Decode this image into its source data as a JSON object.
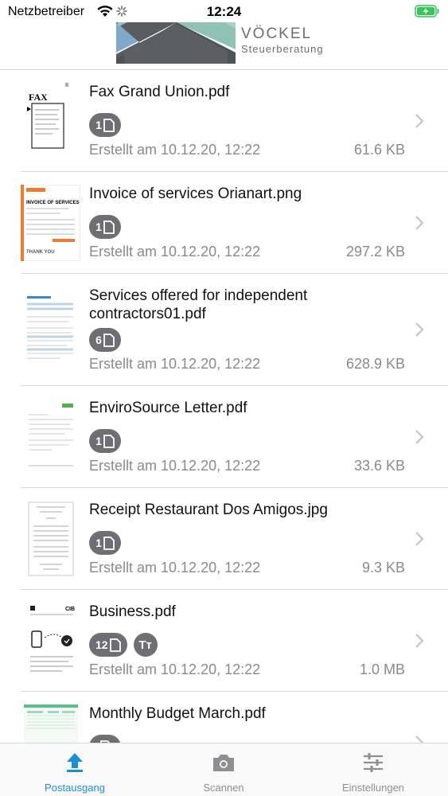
{
  "status_bar": {
    "carrier": "Netzbetreiber",
    "time": "12:24"
  },
  "header": {
    "logo_name": "VÖCKEL",
    "logo_sub": "Steuerberatung"
  },
  "documents": [
    {
      "title": "Fax Grand Union.pdf",
      "pages": "1",
      "created": "Erstellt am 10.12.20, 12:22",
      "size": "61.6 KB",
      "ocr": false
    },
    {
      "title": "Invoice of services Orianart.png",
      "pages": "1",
      "created": "Erstellt am 10.12.20, 12:22",
      "size": "297.2 KB",
      "ocr": false
    },
    {
      "title": "Services offered for independent contractors01.pdf",
      "pages": "6",
      "created": "Erstellt am 10.12.20, 12:22",
      "size": "628.9 KB",
      "ocr": false
    },
    {
      "title": "EnviroSource Letter.pdf",
      "pages": "1",
      "created": "Erstellt am 10.12.20, 12:22",
      "size": "33.6 KB",
      "ocr": false
    },
    {
      "title": "Receipt Restaurant Dos Amigos.jpg",
      "pages": "1",
      "created": "Erstellt am 10.12.20, 12:22",
      "size": "9.3 KB",
      "ocr": false
    },
    {
      "title": "Business.pdf",
      "pages": "12",
      "created": "Erstellt am 10.12.20, 12:22",
      "size": "1.0 MB",
      "ocr": true,
      "ocr_label": "Tт"
    },
    {
      "title": "Monthly Budget March.pdf",
      "pages": "",
      "created": "",
      "size": "",
      "ocr": false
    }
  ],
  "tabs": [
    {
      "label": "Postausgang",
      "icon": "upload-icon",
      "active": true
    },
    {
      "label": "Scannen",
      "icon": "camera-icon",
      "active": false
    },
    {
      "label": "Einstellungen",
      "icon": "sliders-icon",
      "active": false
    }
  ],
  "colors": {
    "accent": "#1a8fd6",
    "badge": "#6e6e73",
    "secondary_text": "#8a8a8e",
    "battery_green": "#34c759"
  }
}
